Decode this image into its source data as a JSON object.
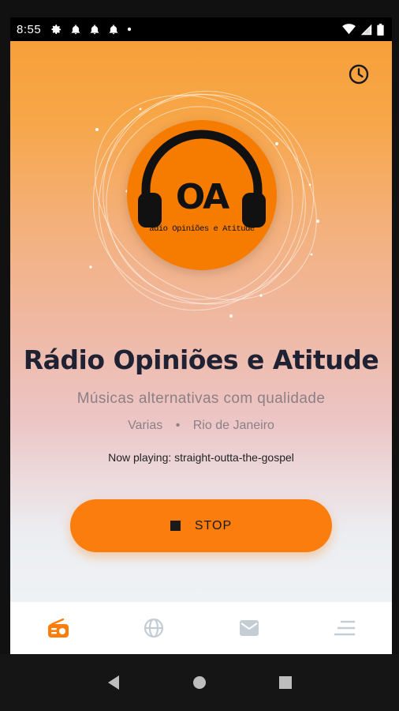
{
  "status_bar": {
    "time": "8:55"
  },
  "station": {
    "logo_initials": "OA",
    "logo_subtitle": "ádio Opiniões e Atitude",
    "name": "Rádio Opiniões e Atitude",
    "tagline": "Músicas alternativas com qualidade",
    "genre": "Varias",
    "separator": "•",
    "location": "Rio de Janeiro",
    "now_playing": "Now playing: straight-outta-the-gospel"
  },
  "player": {
    "stop_label": "STOP"
  },
  "bottom_nav": {
    "active": "radio",
    "items": [
      {
        "id": "radio",
        "icon": "radio-icon"
      },
      {
        "id": "web",
        "icon": "globe-icon"
      },
      {
        "id": "contact",
        "icon": "mail-icon"
      },
      {
        "id": "menu",
        "icon": "sort-menu-icon"
      }
    ]
  },
  "colors": {
    "accent": "#fa7d0d",
    "logo_bg": "#f57c00",
    "title": "#1f2233",
    "inactive_icon": "#c4ccd4"
  }
}
